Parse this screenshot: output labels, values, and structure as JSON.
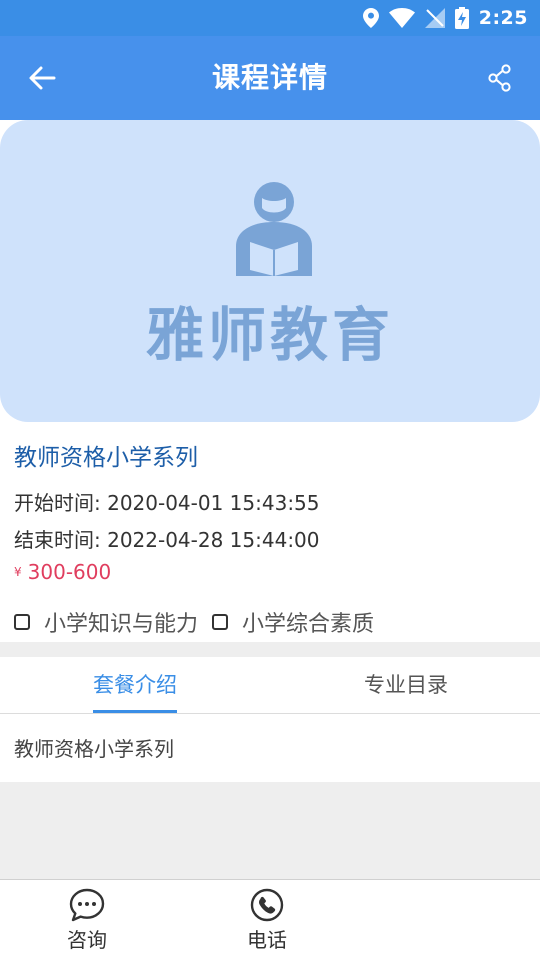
{
  "status_bar": {
    "time": "2:25"
  },
  "app_bar": {
    "title": "课程详情"
  },
  "banner": {
    "brand_text": "雅师教育"
  },
  "course": {
    "title": "教师资格小学系列",
    "start_time": "开始时间: 2020-04-01 15:43:55",
    "end_time": "结束时间: 2022-04-28 15:44:00",
    "price_symbol": "¥",
    "price": "300-600",
    "options": [
      "小学知识与能力",
      "小学综合素质"
    ]
  },
  "tabs": [
    {
      "label": "套餐介绍",
      "active": true
    },
    {
      "label": "专业目录",
      "active": false
    }
  ],
  "intro_text": "教师资格小学系列",
  "bottom_nav": {
    "consult_label": "咨询",
    "phone_label": "电话"
  },
  "colors": {
    "primary": "#4791ec",
    "price": "#e03d5e",
    "title": "#1d5ea8"
  }
}
